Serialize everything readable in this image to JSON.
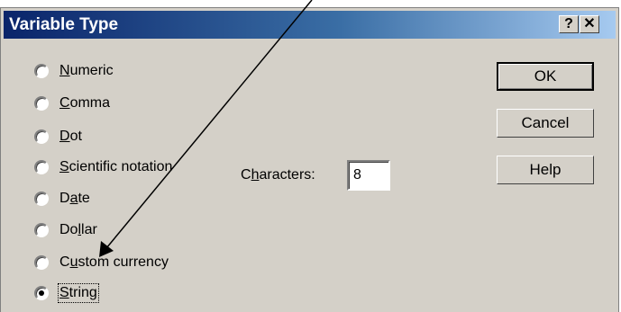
{
  "dialog": {
    "title": "Variable Type",
    "help_btn": "?",
    "close_btn": "✕"
  },
  "radio_options": [
    {
      "pre": "",
      "ul": "N",
      "post": "umeric",
      "checked": false
    },
    {
      "pre": "",
      "ul": "C",
      "post": "omma",
      "checked": false
    },
    {
      "pre": "",
      "ul": "D",
      "post": "ot",
      "checked": false
    },
    {
      "pre": "",
      "ul": "S",
      "post": "cientific notation",
      "checked": false
    },
    {
      "pre": "D",
      "ul": "a",
      "post": "te",
      "checked": false
    },
    {
      "pre": "Do",
      "ul": "l",
      "post": "lar",
      "checked": false
    },
    {
      "pre": "C",
      "ul": "u",
      "post": "stom currency",
      "checked": false
    },
    {
      "pre": "",
      "ul": "S",
      "post": "tring",
      "checked": true
    }
  ],
  "characters": {
    "label_pre": "C",
    "label_ul": "h",
    "label_post": "aracters:",
    "value": "8"
  },
  "buttons": {
    "ok": "OK",
    "cancel": "Cancel",
    "help": "Help"
  }
}
